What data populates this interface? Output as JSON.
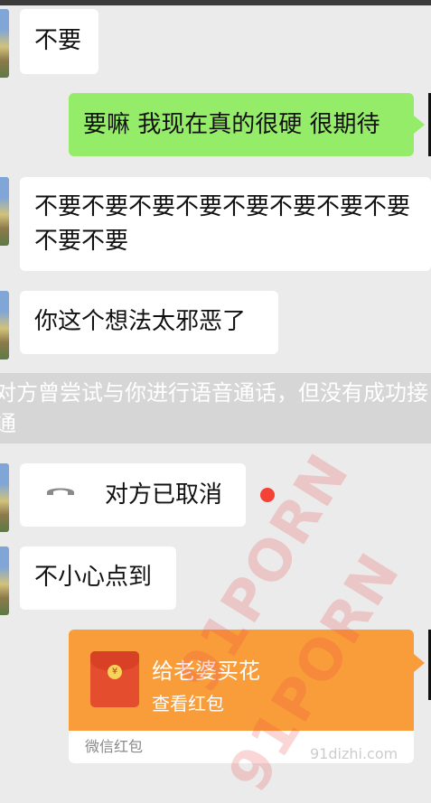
{
  "messages": [
    {
      "side": "left",
      "text": "不要"
    },
    {
      "side": "right",
      "text": "要嘛 我现在真的很硬 很期待"
    },
    {
      "side": "left",
      "text": "不要不要不要不要不要不要不要不要不要不要"
    },
    {
      "side": "left",
      "text": "你这个想法太邪恶了"
    }
  ],
  "notice": "对方曾尝试与你进行语音通话，但没有成功接通",
  "call": {
    "text": "对方已取消",
    "icon": "phone-hangup-icon",
    "missed_dot_color": "#f44336"
  },
  "message_after_call": {
    "side": "left",
    "text": "不小心点到"
  },
  "red_packet": {
    "title": "给老婆买花",
    "subtitle": "查看红包",
    "footer": "微信红包",
    "currency_symbol": "¥",
    "icon": "red-envelope-icon"
  },
  "watermark": {
    "text1": "91PORN",
    "text2": "91PORN",
    "site": "91dizhi.com"
  },
  "colors": {
    "background": "#ebebeb",
    "bubble_left": "#ffffff",
    "bubble_right": "#95ec69",
    "red_packet": "#f99d3a",
    "notice_bg": "#d6d6d6"
  }
}
